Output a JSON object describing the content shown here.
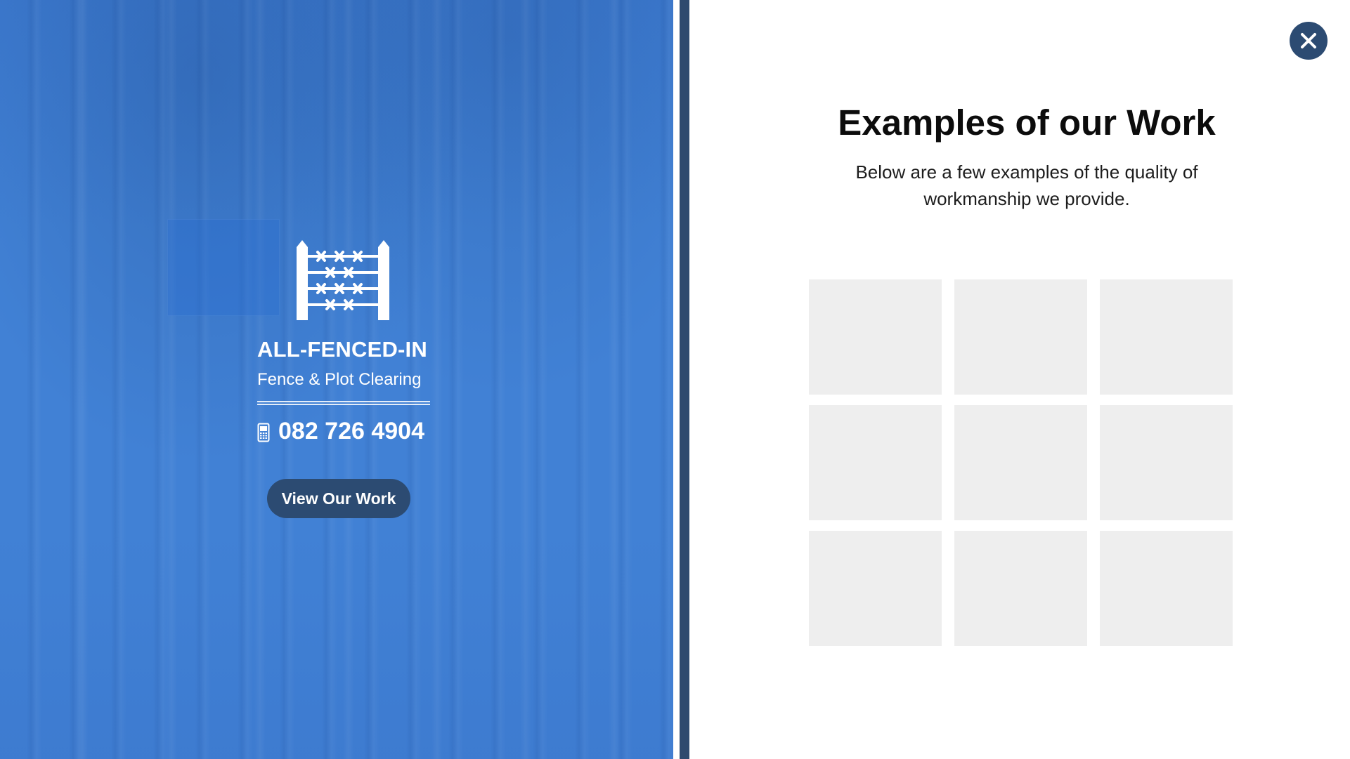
{
  "hero": {
    "brand_name": "ALL-FENCED-IN",
    "tagline": "Fence & Plot Clearing",
    "phone": "082 726 4904",
    "cta_label": "View Our Work",
    "logo_icon": "fence-icon",
    "phone_icon": "mobile-phone-icon",
    "background_color": "#4181d5",
    "button_color": "#2c4b72"
  },
  "divider_color": "#2f4a6e",
  "content": {
    "title": "Examples of our Work",
    "subtitle": "Below are a few examples of the quality of workmanship we provide.",
    "close_icon": "close-icon",
    "gallery_count": 9,
    "gallery_placeholder_color": "#eeeeee"
  }
}
